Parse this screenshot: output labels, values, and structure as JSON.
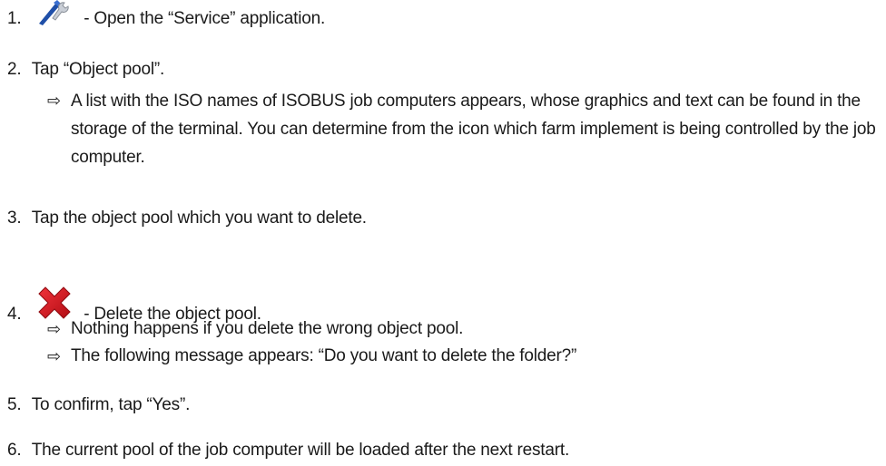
{
  "steps": [
    {
      "number": "1.",
      "icon": "wrench-screwdriver-icon",
      "text": "- Open the “Service” application."
    },
    {
      "number": "2.",
      "text": "Tap “Object pool”."
    },
    {
      "number": "3.",
      "text": "Tap the object pool which you want to delete."
    },
    {
      "number": "4.",
      "icon": "delete-x-icon",
      "text": "- Delete the object pool."
    },
    {
      "number": "5.",
      "text": "To confirm, tap “Yes”."
    },
    {
      "number": "6.",
      "text": "The current pool of the job computer will be loaded after the next restart."
    }
  ],
  "results": {
    "step2": "A list with the ISO names of ISOBUS job computers appears, whose graphics and text can be found in the storage of the terminal. You can determine from the icon which farm implement is being controlled by the job computer.",
    "step4_a": "Nothing happens if you delete the wrong object pool.",
    "step4_b": "The following message appears: “Do you want to delete the folder?”"
  },
  "result_arrow": "⇨",
  "colors": {
    "text": "#1a1a1a",
    "delete_red": "#d9141b",
    "wrench_blue": "#1f4fa8"
  }
}
